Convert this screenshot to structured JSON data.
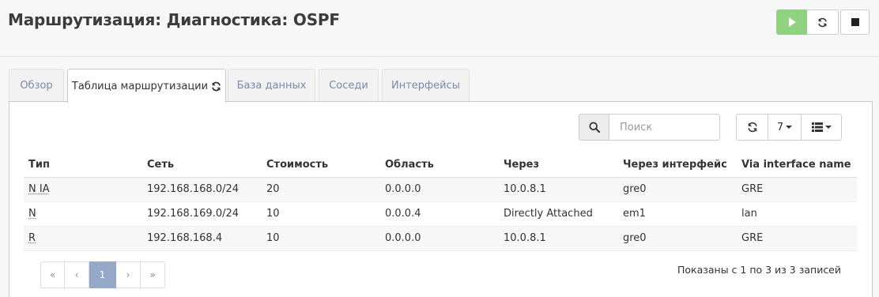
{
  "header": {
    "title": "Маршрутизация: Диагностика: OSPF",
    "play_color": "#8fd27f"
  },
  "tabs": [
    {
      "label": "Обзор",
      "active": false
    },
    {
      "label": "Таблица маршрутизации",
      "active": true,
      "icon": "refresh-icon"
    },
    {
      "label": "База данных",
      "active": false
    },
    {
      "label": "Соседи",
      "active": false
    },
    {
      "label": "Интерфейсы",
      "active": false
    }
  ],
  "toolbar": {
    "search_placeholder": "Поиск",
    "search_value": "",
    "rows_per_page": "7"
  },
  "table": {
    "columns": [
      "Тип",
      "Сеть",
      "Стоимость",
      "Область",
      "Через",
      "Через интерфейс",
      "Via interface name"
    ],
    "rows": [
      [
        "N IA",
        "192.168.168.0/24",
        "20",
        "0.0.0.0",
        "10.0.8.1",
        "gre0",
        "GRE"
      ],
      [
        "N",
        "192.168.169.0/24",
        "10",
        "0.0.0.4",
        "Directly Attached",
        "em1",
        "lan"
      ],
      [
        "R",
        "192.168.168.4",
        "10",
        "0.0.0.0",
        "10.0.8.1",
        "gre0",
        "GRE"
      ]
    ]
  },
  "pagination": {
    "first": "«",
    "prev": "‹",
    "current": "1",
    "next": "›",
    "last": "»",
    "info": "Показаны с 1 по 3 из 3 записей",
    "active_color": "#95a8c8"
  }
}
